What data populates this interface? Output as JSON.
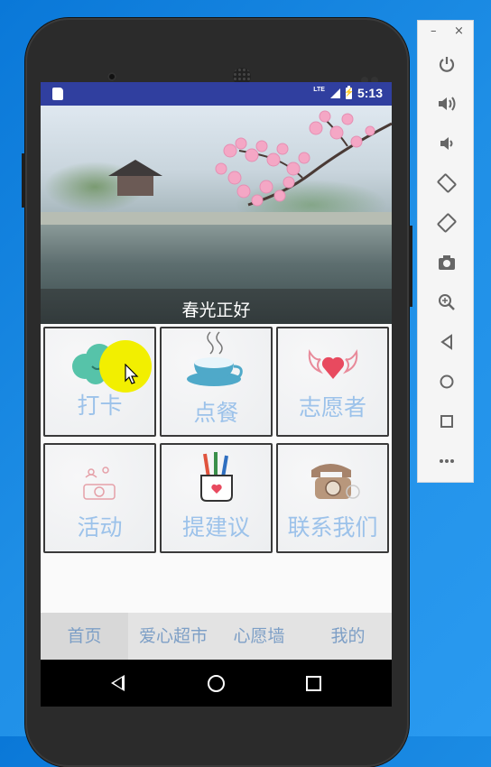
{
  "status": {
    "network": "LTE",
    "time": "5:13"
  },
  "banner": {
    "caption": "春光正好"
  },
  "grid": [
    {
      "label": "打卡",
      "icon": "cloud-face-icon"
    },
    {
      "label": "点餐",
      "icon": "coffee-cup-icon"
    },
    {
      "label": "志愿者",
      "icon": "heart-wings-icon"
    },
    {
      "label": "活动",
      "icon": "camera-doodle-icon"
    },
    {
      "label": "提建议",
      "icon": "pencil-cup-icon"
    },
    {
      "label": "联系我们",
      "icon": "telephone-icon"
    }
  ],
  "bottom_nav": [
    {
      "label": "首页"
    },
    {
      "label": "爱心超市"
    },
    {
      "label": "心愿墙"
    },
    {
      "label": "我的"
    }
  ],
  "emulator_toolbar": {
    "window_min": "–",
    "window_close": "×",
    "buttons": [
      "power-icon",
      "volume-up-icon",
      "volume-down-icon",
      "rotate-left-icon",
      "rotate-right-icon",
      "screenshot-icon",
      "zoom-icon",
      "back-icon",
      "home-icon",
      "overview-icon",
      "more-icon"
    ]
  },
  "colors": {
    "status_bar": "#303f9f",
    "label_blue": "#9cc2ea",
    "nav_text": "#7d9fc6",
    "highlight": "#f2ef00"
  }
}
